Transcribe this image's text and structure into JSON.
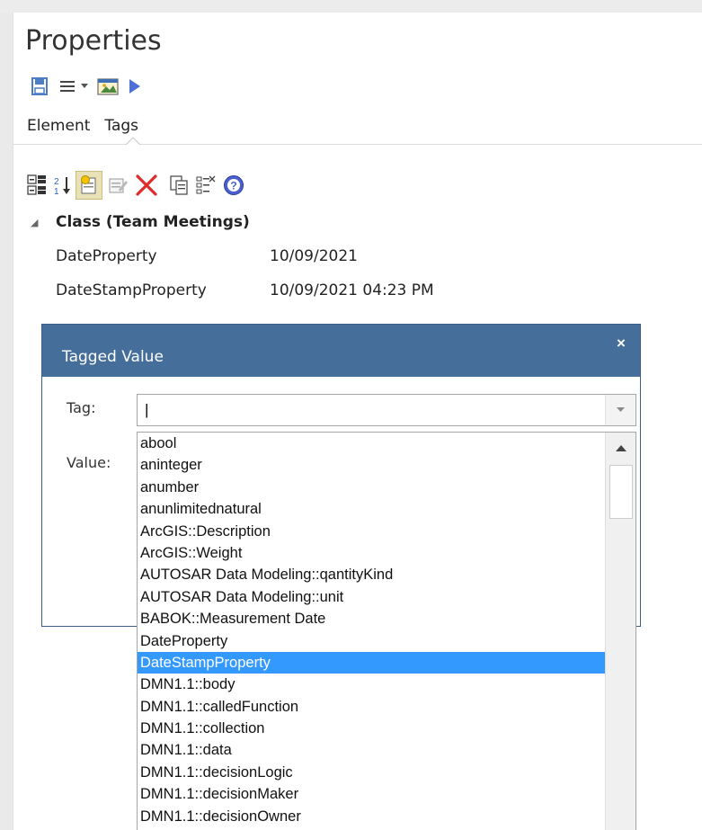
{
  "panel": {
    "title": "Properties"
  },
  "toolbar_top": {
    "icons": [
      "save-icon",
      "menu-icon",
      "dropdown-arrow-icon",
      "image-icon",
      "play-icon"
    ]
  },
  "tabs": [
    {
      "label": "Element"
    },
    {
      "label": "Tags"
    }
  ],
  "toolbar_tags": {
    "icons": [
      "categorized-icon",
      "sort-alpha-icon",
      "new-tag-icon",
      "edit-tag-icon",
      "delete-icon",
      "copy-icon",
      "tag-list-icon",
      "help-icon"
    ]
  },
  "tree": {
    "class_label": "Class (Team Meetings)",
    "properties": [
      {
        "name": "DateProperty",
        "value": "10/09/2021"
      },
      {
        "name": "DateStampProperty",
        "value": "10/09/2021 04:23 PM"
      }
    ]
  },
  "dialog": {
    "title": "Tagged Value",
    "close": "×",
    "tag_label": "Tag:",
    "value_label": "Value:",
    "tag_value": "|"
  },
  "dropdown": {
    "items": [
      "abool",
      "aninteger",
      "anumber",
      "anunlimitednatural",
      "ArcGIS::Description",
      "ArcGIS::Weight",
      "AUTOSAR Data Modeling::qantityKind",
      "AUTOSAR Data Modeling::unit",
      "BABOK::Measurement Date",
      "DateProperty",
      "DateStampProperty",
      "DMN1.1::body",
      "DMN1.1::calledFunction",
      "DMN1.1::collection",
      "DMN1.1::data",
      "DMN1.1::decisionLogic",
      "DMN1.1::decisionMaker",
      "DMN1.1::decisionOwner"
    ],
    "selected": "DateStampProperty"
  },
  "colors": {
    "dialog_header": "#466e9b",
    "selection": "#3399ff"
  }
}
